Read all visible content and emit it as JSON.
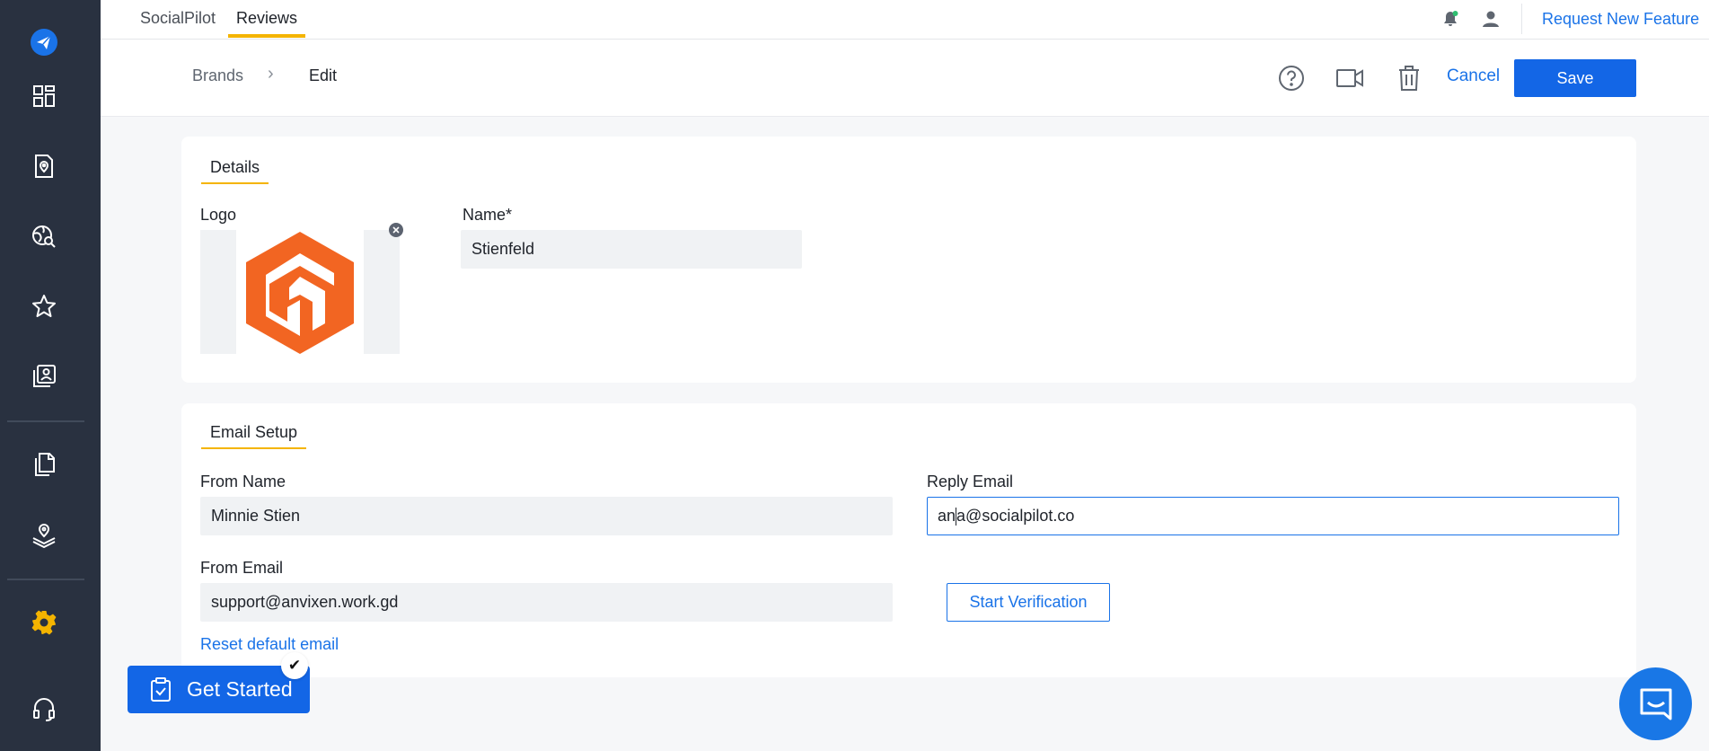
{
  "sidebar": {
    "icons": [
      "send-icon",
      "dashboard-icon",
      "location-document-icon",
      "global-search-icon",
      "star-icon",
      "user-profile-icon",
      "documents-icon",
      "location-layers-icon",
      "gear-icon",
      "headset-icon"
    ]
  },
  "topbar": {
    "tabs": [
      {
        "label": "SocialPilot"
      },
      {
        "label": "Reviews"
      }
    ],
    "active_tab": "Reviews",
    "request_link": "Request New Feature"
  },
  "breadcrumb": {
    "parent": "Brands",
    "separator": "›",
    "current": "Edit"
  },
  "actions": {
    "cancel_label": "Cancel",
    "save_label": "Save"
  },
  "details": {
    "tab_label": "Details",
    "logo_label": "Logo",
    "name_label": "Name*",
    "name_value": "Stienfeld"
  },
  "email_setup": {
    "tab_label": "Email Setup",
    "from_name_label": "From Name",
    "from_name_value": "Minnie Stien",
    "reply_email_label": "Reply Email",
    "reply_email_before_caret": "an",
    "reply_email_after_caret": "a@socialpilot.co",
    "from_email_label": "From Email",
    "from_email_value": "support@anvixen.work.gd",
    "verify_label": "Start Verification",
    "reset_label": "Reset default email"
  },
  "get_started": {
    "label": "Get Started"
  },
  "colors": {
    "sidebar_bg": "#293140",
    "primary": "#1366e6",
    "accent": "#f4b400",
    "logo_orange": "#f26522",
    "link": "#1a73e8"
  }
}
